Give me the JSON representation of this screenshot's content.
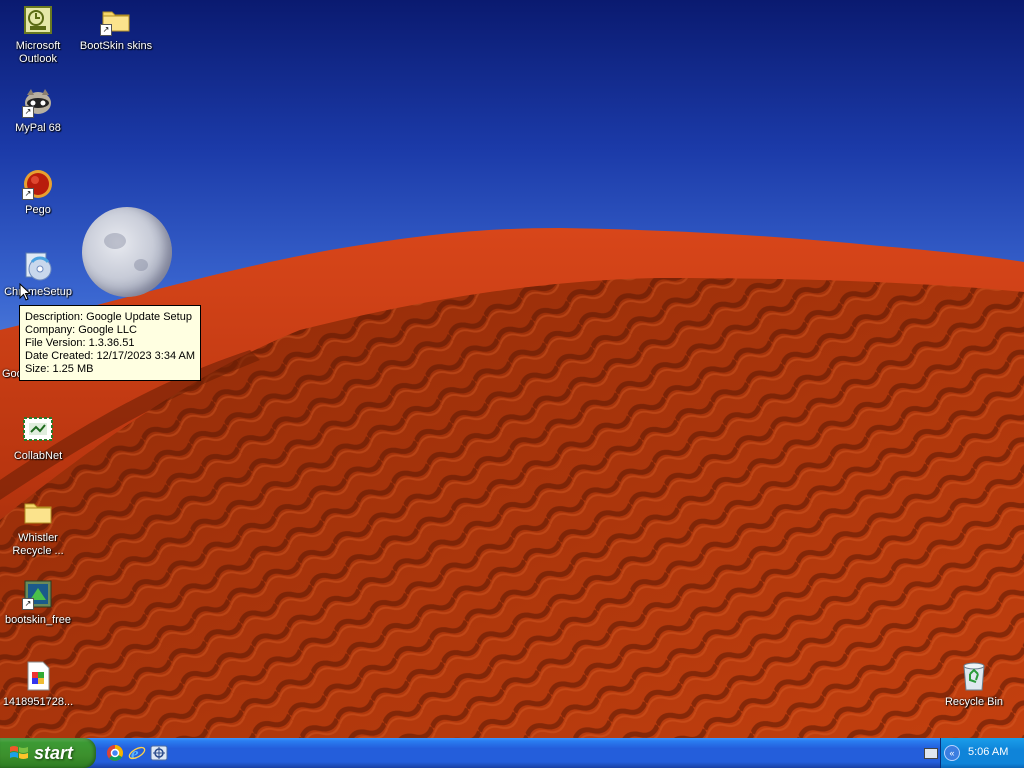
{
  "desktop": {
    "icons": [
      {
        "label": "Microsoft Outlook",
        "icon": "outlook-icon"
      },
      {
        "label": "BootSkin skins",
        "icon": "folder-icon"
      },
      {
        "label": "MyPal 68",
        "icon": "mypal-browser-icon"
      },
      {
        "label": "Pego",
        "icon": "pego-icon"
      },
      {
        "label": "ChromeSetup",
        "icon": "setup-cd-icon"
      },
      {
        "label": "Goo",
        "icon": "google-icon"
      },
      {
        "label": "CollabNet",
        "icon": "collabnet-icon"
      },
      {
        "label": "Whistler Recycle ...",
        "icon": "folder-icon"
      },
      {
        "label": "bootskin_free",
        "icon": "bootskin-icon"
      },
      {
        "label": "1418951728...",
        "icon": "image-file-icon"
      },
      {
        "label": "Recycle Bin",
        "icon": "recycle-bin-icon"
      }
    ]
  },
  "tooltip": {
    "lines": [
      "Description: Google Update Setup",
      "Company: Google LLC",
      "File Version: 1.3.36.51",
      "Date Created: 12/17/2023 3:34 AM",
      "Size: 1.25 MB"
    ]
  },
  "taskbar": {
    "start_label": "start",
    "quick_launch": [
      "chrome-icon",
      "internet-explorer-icon",
      "desktop-shortcut-icon"
    ],
    "clock": "5:06 AM"
  },
  "colors": {
    "taskbar": "#245edb",
    "start_button": "#3c8f2c",
    "tray": "#0f84d9",
    "tooltip_bg": "#ffffe1"
  }
}
